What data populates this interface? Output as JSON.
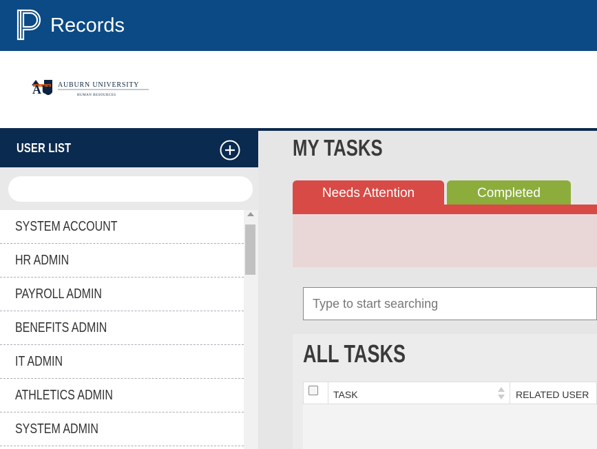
{
  "header": {
    "app_title": "Records",
    "logo_icon": "powerschool-p-logo",
    "bg_color": "#0b4a84"
  },
  "brand": {
    "university_name": "AUBURN UNIVERSITY",
    "department": "HUMAN RESOURCES",
    "logo_icon": "auburn-au-logo"
  },
  "sidebar": {
    "title": "USER LIST",
    "add_icon": "plus-circle-icon",
    "search_value": "",
    "items": [
      {
        "label": "SYSTEM ACCOUNT"
      },
      {
        "label": "HR ADMIN"
      },
      {
        "label": "PAYROLL ADMIN"
      },
      {
        "label": "BENEFITS ADMIN"
      },
      {
        "label": "IT ADMIN"
      },
      {
        "label": "ATHLETICS ADMIN"
      },
      {
        "label": "SYSTEM ADMIN"
      }
    ]
  },
  "main": {
    "my_tasks_title": "MY TASKS",
    "tabs": [
      {
        "label": "Needs Attention",
        "color": "#d84a45",
        "active": true
      },
      {
        "label": "Completed",
        "color": "#8cad3c",
        "active": false
      }
    ],
    "search_placeholder": "Type to start searching",
    "all_tasks_title": "ALL TASKS",
    "table": {
      "columns": [
        "TASK",
        "RELATED USER"
      ]
    }
  }
}
